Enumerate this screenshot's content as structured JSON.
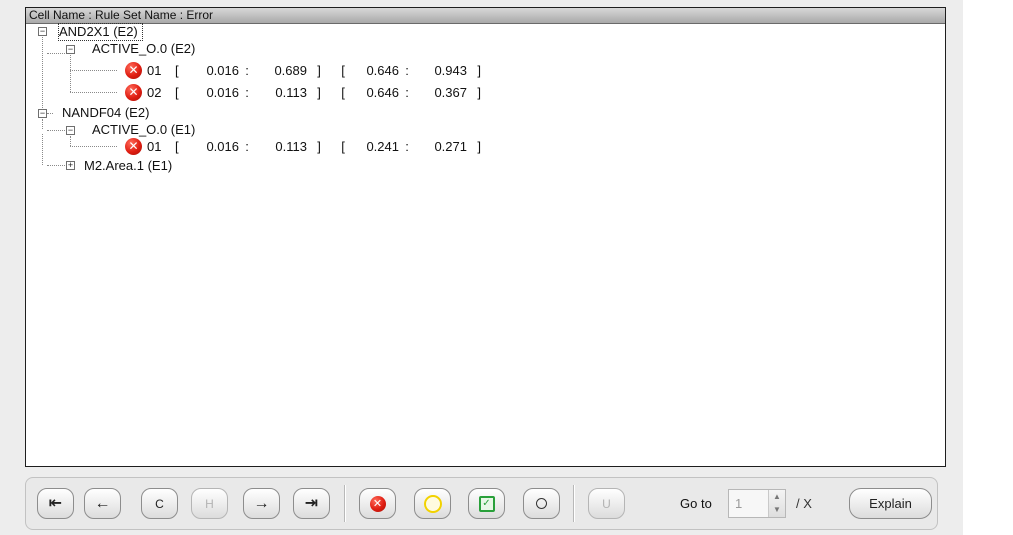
{
  "tree": {
    "header": "Cell Name : Rule Set Name : Error",
    "cells": [
      {
        "label": "AND2X1 (E2)",
        "rules": [
          {
            "label": "ACTIVE_O.0 (E2)",
            "errors": [
              {
                "id": "01",
                "b1": "[",
                "v1": "0.016",
                "sep1": ":",
                "v2": "0.689",
                "b2": "]",
                "b3": "[",
                "v3": "0.646",
                "sep2": ":",
                "v4": "0.943",
                "b4": "]"
              },
              {
                "id": "02",
                "b1": "[",
                "v1": "0.016",
                "sep1": ":",
                "v2": "0.113",
                "b2": "]",
                "b3": "[",
                "v3": "0.646",
                "sep2": ":",
                "v4": "0.367",
                "b4": "]"
              }
            ]
          }
        ]
      },
      {
        "label": "NANDF04 (E2)",
        "rules": [
          {
            "label": "ACTIVE_O.0 (E1)",
            "errors": [
              {
                "id": "01",
                "b1": "[",
                "v1": "0.016",
                "sep1": ":",
                "v2": "0.113",
                "b2": "]",
                "b3": "[",
                "v3": "0.241",
                "sep2": ":",
                "v4": "0.271",
                "b4": "]"
              }
            ]
          },
          {
            "label": "M2.Area.1 (E1)",
            "errors": []
          }
        ]
      }
    ],
    "expander_open": "−",
    "expander_closed": "+",
    "error_glyph": "✕"
  },
  "toolbar": {
    "first_glyph": "⇤",
    "prev_glyph": "←",
    "c_label": "C",
    "h_label": "H",
    "next_glyph": "→",
    "last_glyph": "⇥",
    "error_glyph": "✕",
    "check_glyph": "✓",
    "u_label": "U",
    "goto_label": "Go to",
    "goto_value": "1",
    "spin_up": "▲",
    "spin_down": "▼",
    "goto_total": "/ X",
    "explain_label": "Explain"
  },
  "icons": {
    "error": "error-icon",
    "warning": "yellow-ring-icon",
    "checked": "green-check-icon",
    "waived": "small-ring-icon"
  },
  "colors": {
    "error_red": "#e01e12",
    "warning_yellow": "#f2d200",
    "check_green": "#29a03a"
  }
}
